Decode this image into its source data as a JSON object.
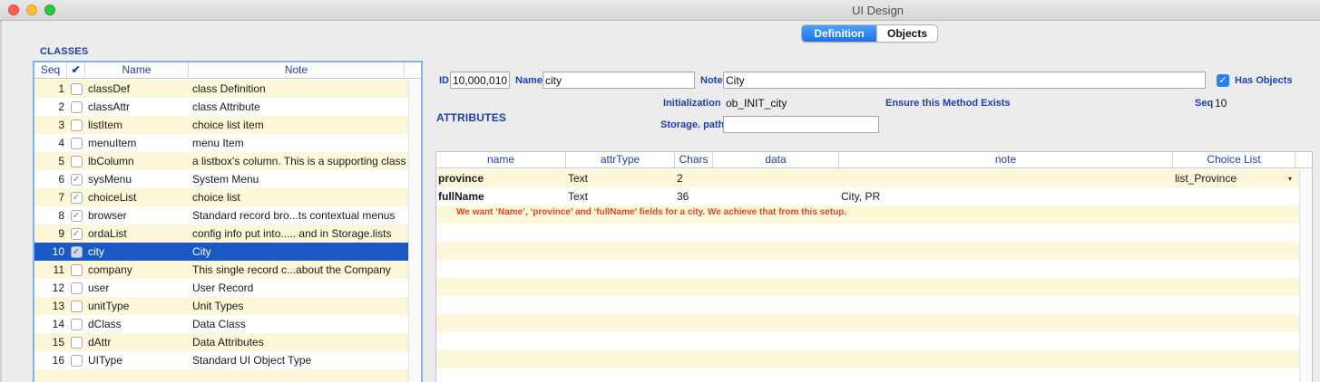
{
  "window": {
    "title": "UI Design"
  },
  "tabs": {
    "definition": "Definition",
    "objects": "Objects",
    "active": "Definition"
  },
  "classes": {
    "section_title": "CLASSES",
    "headers": {
      "seq": "Seq",
      "check": "✔",
      "name": "Name",
      "note": "Note"
    },
    "rows": [
      {
        "seq": "1",
        "checked": false,
        "name": "classDef",
        "note": "class Definition"
      },
      {
        "seq": "2",
        "checked": false,
        "name": "classAttr",
        "note": "class Attribute"
      },
      {
        "seq": "3",
        "checked": false,
        "name": "listItem",
        "note": "choice list item"
      },
      {
        "seq": "4",
        "checked": false,
        "name": "menuItem",
        "note": "menu Item"
      },
      {
        "seq": "5",
        "checked": false,
        "name": "lbColumn",
        "note": "a listbox's column. This is a supporting class"
      },
      {
        "seq": "6",
        "checked": true,
        "name": "sysMenu",
        "note": "System Menu"
      },
      {
        "seq": "7",
        "checked": true,
        "name": "choiceList",
        "note": "choice list"
      },
      {
        "seq": "8",
        "checked": true,
        "name": "browser",
        "note": "Standard record bro...ts contextual menus"
      },
      {
        "seq": "9",
        "checked": true,
        "name": "ordaList",
        "note": "config info put into..... and in Storage.lists"
      },
      {
        "seq": "10",
        "checked": true,
        "name": "city",
        "note": "City",
        "selected": true
      },
      {
        "seq": "11",
        "checked": false,
        "name": "company",
        "note": "This single record c...about the Company"
      },
      {
        "seq": "12",
        "checked": false,
        "name": "user",
        "note": "User Record"
      },
      {
        "seq": "13",
        "checked": false,
        "name": "unitType",
        "note": "Unit Types"
      },
      {
        "seq": "14",
        "checked": false,
        "name": "dClass",
        "note": "Data Class"
      },
      {
        "seq": "15",
        "checked": false,
        "name": "dAttr",
        "note": "Data Attributes"
      },
      {
        "seq": "16",
        "checked": false,
        "name": "UIType",
        "note": "Standard UI Object Type"
      }
    ]
  },
  "form": {
    "id_label": "ID",
    "id_value": "10,000,010",
    "name_label": "Name",
    "name_value": "city",
    "note_label": "Note",
    "note_value": "City",
    "has_objects_label": "Has Objects",
    "has_objects_checked": true,
    "initialization_label": "Initialization",
    "initialization_value": "ob_INIT_city",
    "ensure_label": "Ensure this Method Exists",
    "seq_label": "Seq",
    "seq_value": "10",
    "storage_label": "Storage. path",
    "storage_value": ""
  },
  "attributes": {
    "section_title": "ATTRIBUTES",
    "headers": {
      "name": "name",
      "attrType": "attrType",
      "chars": "Chars",
      "data": "data",
      "note": "note",
      "choice": "Choice List"
    },
    "rows": [
      {
        "name": "province",
        "attrType": "Text",
        "chars": "2",
        "data": "",
        "note": "",
        "choice": "list_Province"
      },
      {
        "name": "fullName",
        "attrType": "Text",
        "chars": "36",
        "data": "",
        "note": "City, PR",
        "choice": ""
      }
    ],
    "annotation": "We want ‘Name’, ‘province’ and ‘fullName’ fields for a city. We achieve that from this setup."
  },
  "colors": {
    "accent": "#1e73e8",
    "label_blue": "#1d3fb3",
    "row_stripe": "#fdf7d9",
    "selection": "#1b58c2",
    "annotation_red": "#e4462d"
  }
}
